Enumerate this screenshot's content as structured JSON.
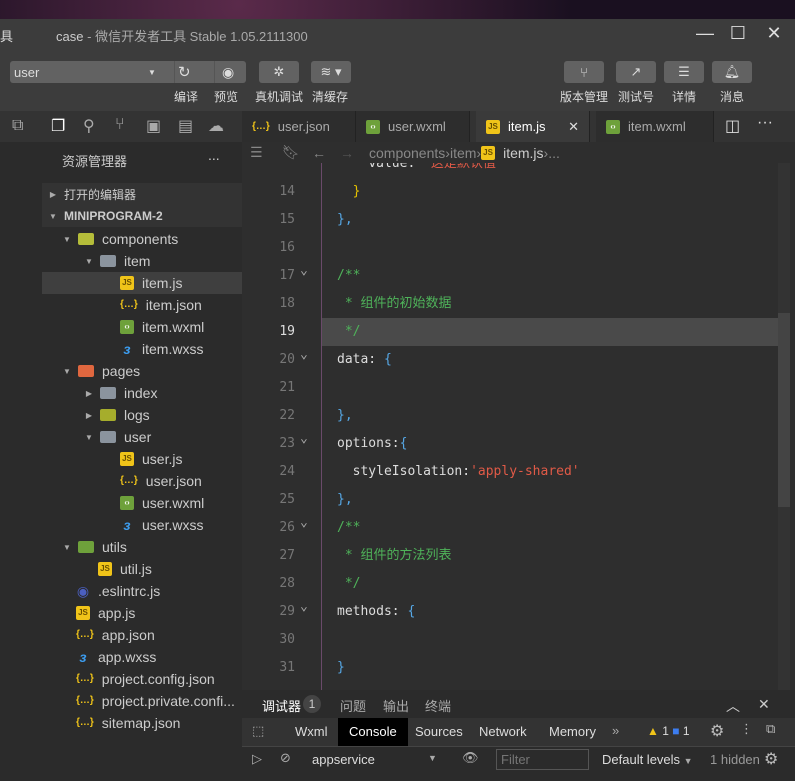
{
  "window": {
    "app_fragment": "具",
    "title_project": "case",
    "title_sep": "-",
    "title_app": "微信开发者工具 Stable 1.05.2111300"
  },
  "toolbar": {
    "page_select": "user",
    "compile": "编译",
    "preview": "预览",
    "remote_debug": "真机调试",
    "clear_cache": "清缓存",
    "version": "版本管理",
    "test": "测试号",
    "details": "详情",
    "messages": "消息"
  },
  "tabs": [
    {
      "label": "user.json",
      "type": "json"
    },
    {
      "label": "user.wxml",
      "type": "wxml"
    },
    {
      "label": "item.js",
      "type": "js",
      "active": true
    },
    {
      "label": "item.wxml",
      "type": "wxml"
    }
  ],
  "breadcrumb": [
    "components",
    "item",
    "item.js",
    "..."
  ],
  "explorer": {
    "title": "资源管理器",
    "more": "...",
    "open_editors": "打开的编辑器",
    "project": "MINIPROGRAM-2",
    "tree": [
      {
        "label": "components",
        "type": "folder-comp",
        "depth": 1,
        "open": true
      },
      {
        "label": "item",
        "type": "folder",
        "depth": 2,
        "open": true
      },
      {
        "label": "item.js",
        "type": "js",
        "depth": 3,
        "selected": true
      },
      {
        "label": "item.json",
        "type": "json",
        "depth": 3
      },
      {
        "label": "item.wxml",
        "type": "wxml",
        "depth": 3
      },
      {
        "label": "item.wxss",
        "type": "wxss",
        "depth": 3
      },
      {
        "label": "pages",
        "type": "folder-pages",
        "depth": 1,
        "open": true
      },
      {
        "label": "index",
        "type": "folder",
        "depth": 2,
        "open": false
      },
      {
        "label": "logs",
        "type": "folder-logs",
        "depth": 2,
        "open": false
      },
      {
        "label": "user",
        "type": "folder",
        "depth": 2,
        "open": true
      },
      {
        "label": "user.js",
        "type": "js",
        "depth": 3
      },
      {
        "label": "user.json",
        "type": "json",
        "depth": 3
      },
      {
        "label": "user.wxml",
        "type": "wxml",
        "depth": 3
      },
      {
        "label": "user.wxss",
        "type": "wxss",
        "depth": 3
      },
      {
        "label": "utils",
        "type": "folder-utils",
        "depth": 1,
        "open": true
      },
      {
        "label": "util.js",
        "type": "js",
        "depth": 2
      },
      {
        "label": ".eslintrc.js",
        "type": "eslint",
        "depth": 1
      },
      {
        "label": "app.js",
        "type": "js",
        "depth": 1
      },
      {
        "label": "app.json",
        "type": "json",
        "depth": 1
      },
      {
        "label": "app.wxss",
        "type": "wxss",
        "depth": 1
      },
      {
        "label": "project.config.json",
        "type": "json",
        "depth": 1
      },
      {
        "label": "project.private.confi...",
        "type": "json",
        "depth": 1
      },
      {
        "label": "sitemap.json",
        "type": "json",
        "depth": 1
      }
    ]
  },
  "code": {
    "current_line": 19,
    "lines": [
      {
        "n": "",
        "fold": false,
        "t": [
          [
            "    ",
            ""
          ],
          [
            "value: ",
            "c-k"
          ],
          [
            "'这是默认值'",
            "c-s"
          ]
        ]
      },
      {
        "n": "14",
        "t": [
          [
            "  ",
            ""
          ],
          [
            "}",
            "c-y"
          ]
        ]
      },
      {
        "n": "15",
        "t": [
          [
            "},",
            "c-b"
          ]
        ]
      },
      {
        "n": "16",
        "t": []
      },
      {
        "n": "17",
        "fold": true,
        "t": [
          [
            "/**",
            "c-c"
          ]
        ]
      },
      {
        "n": "18",
        "t": [
          [
            " * 组件的初始数据",
            "c-c"
          ]
        ]
      },
      {
        "n": "19",
        "t": [
          [
            " */",
            "c-c"
          ]
        ]
      },
      {
        "n": "20",
        "fold": true,
        "t": [
          [
            "data: ",
            "c-k"
          ],
          [
            "{",
            "c-b"
          ]
        ]
      },
      {
        "n": "21",
        "t": []
      },
      {
        "n": "22",
        "t": [
          [
            "},",
            "c-b"
          ]
        ]
      },
      {
        "n": "23",
        "fold": true,
        "t": [
          [
            "options:",
            "c-k"
          ],
          [
            "{",
            "c-b"
          ]
        ]
      },
      {
        "n": "24",
        "t": [
          [
            "  styleIsolation:",
            "c-k"
          ],
          [
            "'apply-shared'",
            "c-s"
          ]
        ]
      },
      {
        "n": "25",
        "t": [
          [
            "},",
            "c-b"
          ]
        ]
      },
      {
        "n": "26",
        "fold": true,
        "t": [
          [
            "/**",
            "c-c"
          ]
        ]
      },
      {
        "n": "27",
        "t": [
          [
            " * 组件的方法列表",
            "c-c"
          ]
        ]
      },
      {
        "n": "28",
        "t": [
          [
            " */",
            "c-c"
          ]
        ]
      },
      {
        "n": "29",
        "fold": true,
        "t": [
          [
            "methods: ",
            "c-k"
          ],
          [
            "{",
            "c-b"
          ]
        ]
      },
      {
        "n": "30",
        "t": []
      },
      {
        "n": "31",
        "t": [
          [
            "}",
            "c-b"
          ]
        ]
      }
    ]
  },
  "panel": {
    "debugger": "调试器",
    "badge": "1",
    "problems": "问题",
    "output": "输出",
    "terminal": "终端",
    "devtabs": [
      "Wxml",
      "Console",
      "Sources",
      "Network",
      "Memory"
    ],
    "more": "»",
    "warnings": "1",
    "infos": "1",
    "context": "appservice",
    "filter_placeholder": "Filter",
    "levels": "Default levels",
    "hidden": "1 hidden"
  }
}
